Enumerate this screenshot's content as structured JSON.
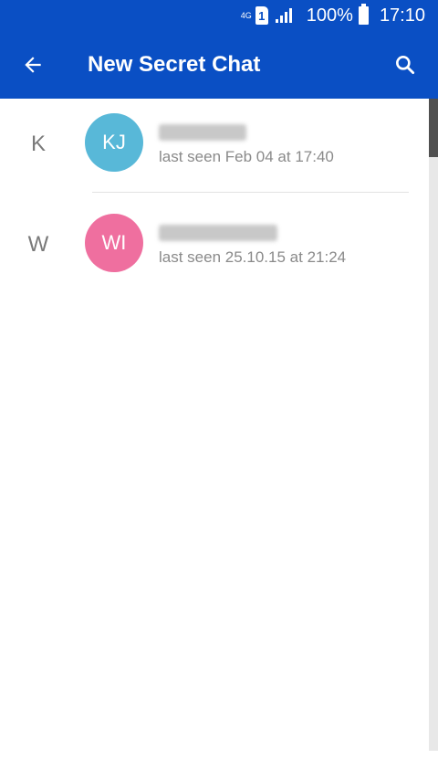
{
  "status_bar": {
    "network": "4G",
    "sim": "1",
    "battery": "100%",
    "time": "17:10"
  },
  "header": {
    "title": "New Secret Chat",
    "back_icon": "arrow-left-icon",
    "search_icon": "search-icon",
    "color": "#0a4fc4"
  },
  "contacts": [
    {
      "section_letter": "K",
      "initials": "KJ",
      "avatar_color": "#58b8d8",
      "status": "last seen Feb 04 at 17:40"
    },
    {
      "section_letter": "W",
      "initials": "WI",
      "avatar_color": "#ef6f9f",
      "status": "last seen 25.10.15 at 21:24"
    }
  ]
}
